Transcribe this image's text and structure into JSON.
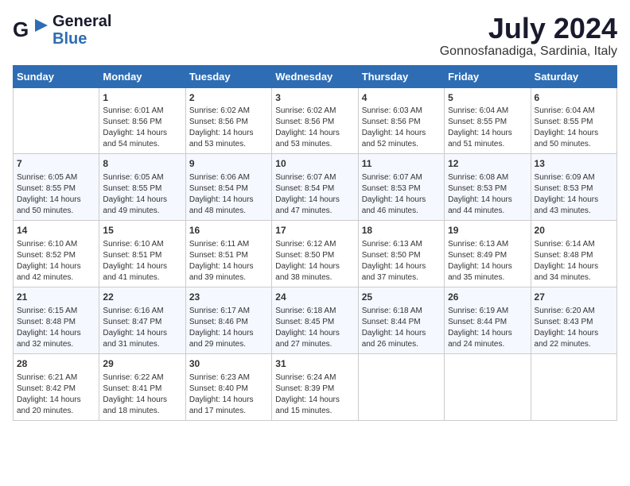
{
  "header": {
    "logo_general": "General",
    "logo_blue": "Blue",
    "month_title": "July 2024",
    "location": "Gonnosfanadiga, Sardinia, Italy"
  },
  "weekdays": [
    "Sunday",
    "Monday",
    "Tuesday",
    "Wednesday",
    "Thursday",
    "Friday",
    "Saturday"
  ],
  "weeks": [
    [
      {
        "day": "",
        "sunrise": "",
        "sunset": "",
        "daylight": ""
      },
      {
        "day": "1",
        "sunrise": "Sunrise: 6:01 AM",
        "sunset": "Sunset: 8:56 PM",
        "daylight": "Daylight: 14 hours and 54 minutes."
      },
      {
        "day": "2",
        "sunrise": "Sunrise: 6:02 AM",
        "sunset": "Sunset: 8:56 PM",
        "daylight": "Daylight: 14 hours and 53 minutes."
      },
      {
        "day": "3",
        "sunrise": "Sunrise: 6:02 AM",
        "sunset": "Sunset: 8:56 PM",
        "daylight": "Daylight: 14 hours and 53 minutes."
      },
      {
        "day": "4",
        "sunrise": "Sunrise: 6:03 AM",
        "sunset": "Sunset: 8:56 PM",
        "daylight": "Daylight: 14 hours and 52 minutes."
      },
      {
        "day": "5",
        "sunrise": "Sunrise: 6:04 AM",
        "sunset": "Sunset: 8:55 PM",
        "daylight": "Daylight: 14 hours and 51 minutes."
      },
      {
        "day": "6",
        "sunrise": "Sunrise: 6:04 AM",
        "sunset": "Sunset: 8:55 PM",
        "daylight": "Daylight: 14 hours and 50 minutes."
      }
    ],
    [
      {
        "day": "7",
        "sunrise": "Sunrise: 6:05 AM",
        "sunset": "Sunset: 8:55 PM",
        "daylight": "Daylight: 14 hours and 50 minutes."
      },
      {
        "day": "8",
        "sunrise": "Sunrise: 6:05 AM",
        "sunset": "Sunset: 8:55 PM",
        "daylight": "Daylight: 14 hours and 49 minutes."
      },
      {
        "day": "9",
        "sunrise": "Sunrise: 6:06 AM",
        "sunset": "Sunset: 8:54 PM",
        "daylight": "Daylight: 14 hours and 48 minutes."
      },
      {
        "day": "10",
        "sunrise": "Sunrise: 6:07 AM",
        "sunset": "Sunset: 8:54 PM",
        "daylight": "Daylight: 14 hours and 47 minutes."
      },
      {
        "day": "11",
        "sunrise": "Sunrise: 6:07 AM",
        "sunset": "Sunset: 8:53 PM",
        "daylight": "Daylight: 14 hours and 46 minutes."
      },
      {
        "day": "12",
        "sunrise": "Sunrise: 6:08 AM",
        "sunset": "Sunset: 8:53 PM",
        "daylight": "Daylight: 14 hours and 44 minutes."
      },
      {
        "day": "13",
        "sunrise": "Sunrise: 6:09 AM",
        "sunset": "Sunset: 8:53 PM",
        "daylight": "Daylight: 14 hours and 43 minutes."
      }
    ],
    [
      {
        "day": "14",
        "sunrise": "Sunrise: 6:10 AM",
        "sunset": "Sunset: 8:52 PM",
        "daylight": "Daylight: 14 hours and 42 minutes."
      },
      {
        "day": "15",
        "sunrise": "Sunrise: 6:10 AM",
        "sunset": "Sunset: 8:51 PM",
        "daylight": "Daylight: 14 hours and 41 minutes."
      },
      {
        "day": "16",
        "sunrise": "Sunrise: 6:11 AM",
        "sunset": "Sunset: 8:51 PM",
        "daylight": "Daylight: 14 hours and 39 minutes."
      },
      {
        "day": "17",
        "sunrise": "Sunrise: 6:12 AM",
        "sunset": "Sunset: 8:50 PM",
        "daylight": "Daylight: 14 hours and 38 minutes."
      },
      {
        "day": "18",
        "sunrise": "Sunrise: 6:13 AM",
        "sunset": "Sunset: 8:50 PM",
        "daylight": "Daylight: 14 hours and 37 minutes."
      },
      {
        "day": "19",
        "sunrise": "Sunrise: 6:13 AM",
        "sunset": "Sunset: 8:49 PM",
        "daylight": "Daylight: 14 hours and 35 minutes."
      },
      {
        "day": "20",
        "sunrise": "Sunrise: 6:14 AM",
        "sunset": "Sunset: 8:48 PM",
        "daylight": "Daylight: 14 hours and 34 minutes."
      }
    ],
    [
      {
        "day": "21",
        "sunrise": "Sunrise: 6:15 AM",
        "sunset": "Sunset: 8:48 PM",
        "daylight": "Daylight: 14 hours and 32 minutes."
      },
      {
        "day": "22",
        "sunrise": "Sunrise: 6:16 AM",
        "sunset": "Sunset: 8:47 PM",
        "daylight": "Daylight: 14 hours and 31 minutes."
      },
      {
        "day": "23",
        "sunrise": "Sunrise: 6:17 AM",
        "sunset": "Sunset: 8:46 PM",
        "daylight": "Daylight: 14 hours and 29 minutes."
      },
      {
        "day": "24",
        "sunrise": "Sunrise: 6:18 AM",
        "sunset": "Sunset: 8:45 PM",
        "daylight": "Daylight: 14 hours and 27 minutes."
      },
      {
        "day": "25",
        "sunrise": "Sunrise: 6:18 AM",
        "sunset": "Sunset: 8:44 PM",
        "daylight": "Daylight: 14 hours and 26 minutes."
      },
      {
        "day": "26",
        "sunrise": "Sunrise: 6:19 AM",
        "sunset": "Sunset: 8:44 PM",
        "daylight": "Daylight: 14 hours and 24 minutes."
      },
      {
        "day": "27",
        "sunrise": "Sunrise: 6:20 AM",
        "sunset": "Sunset: 8:43 PM",
        "daylight": "Daylight: 14 hours and 22 minutes."
      }
    ],
    [
      {
        "day": "28",
        "sunrise": "Sunrise: 6:21 AM",
        "sunset": "Sunset: 8:42 PM",
        "daylight": "Daylight: 14 hours and 20 minutes."
      },
      {
        "day": "29",
        "sunrise": "Sunrise: 6:22 AM",
        "sunset": "Sunset: 8:41 PM",
        "daylight": "Daylight: 14 hours and 18 minutes."
      },
      {
        "day": "30",
        "sunrise": "Sunrise: 6:23 AM",
        "sunset": "Sunset: 8:40 PM",
        "daylight": "Daylight: 14 hours and 17 minutes."
      },
      {
        "day": "31",
        "sunrise": "Sunrise: 6:24 AM",
        "sunset": "Sunset: 8:39 PM",
        "daylight": "Daylight: 14 hours and 15 minutes."
      },
      {
        "day": "",
        "sunrise": "",
        "sunset": "",
        "daylight": ""
      },
      {
        "day": "",
        "sunrise": "",
        "sunset": "",
        "daylight": ""
      },
      {
        "day": "",
        "sunrise": "",
        "sunset": "",
        "daylight": ""
      }
    ]
  ]
}
